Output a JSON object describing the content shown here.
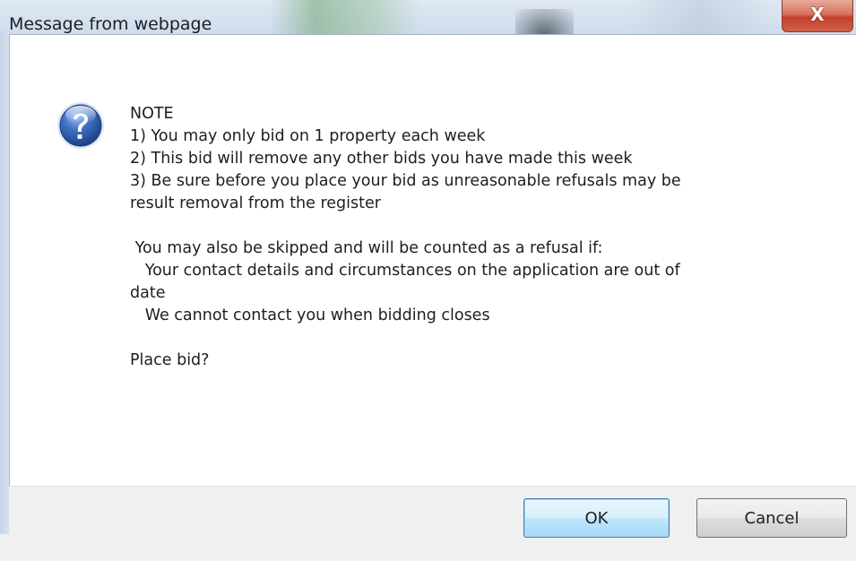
{
  "dialog": {
    "title": "Message from webpage",
    "close_label": "X",
    "icon": "question-icon",
    "message": "NOTE\n1) You may only bid on 1 property each week\n2) This bid will remove any other bids you have made this week\n3) Be sure before you place your bid as unreasonable refusals may be\nresult removal from the register\n\n You may also be skipped and will be counted as a refusal if:\n   Your contact details and circumstances on the application are out of\ndate\n   We cannot contact you when bidding closes\n\nPlace bid?",
    "buttons": {
      "ok_label": "OK",
      "cancel_label": "Cancel"
    }
  },
  "colors": {
    "close_button": "#c4402a",
    "icon_blue": "#2f63b3",
    "ok_button_border": "#3c7fb1"
  }
}
